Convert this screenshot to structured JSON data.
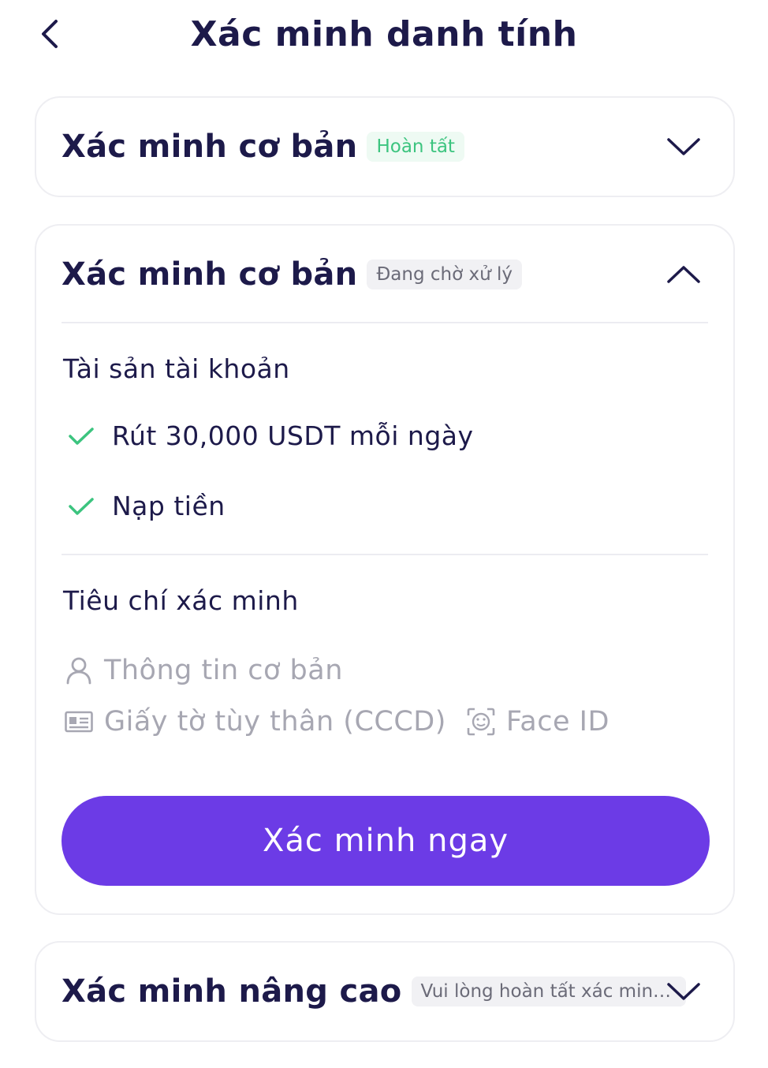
{
  "header": {
    "title": "Xác minh danh tính"
  },
  "cards": [
    {
      "title": "Xác minh cơ bản",
      "badge": "Hoàn tất",
      "expanded": false
    },
    {
      "title": "Xác minh cơ bản",
      "badge": "Đang chờ xử lý",
      "expanded": true,
      "assets_label": "Tài sản tài khoản",
      "benefits": [
        "Rút 30,000 USDT mỗi ngày",
        "Nạp tiền"
      ],
      "criteria_label": "Tiêu chí xác minh",
      "criteria": [
        "Thông tin cơ bản",
        "Giấy tờ tùy thân (CCCD)",
        "Face ID"
      ],
      "button_label": "Xác minh ngay"
    },
    {
      "title": "Xác minh nâng cao",
      "badge": "Vui lòng hoàn tất xác minh cơ bản",
      "expanded": false
    }
  ],
  "colors": {
    "primary": "#6c3be6",
    "title_text": "#1d1a4a",
    "success": "#3cc47f",
    "muted": "#a7a7b2"
  },
  "icons": [
    "back-arrow-icon",
    "chevron-down-icon",
    "chevron-up-icon",
    "check-icon",
    "user-icon",
    "id-card-icon",
    "face-id-icon"
  ]
}
